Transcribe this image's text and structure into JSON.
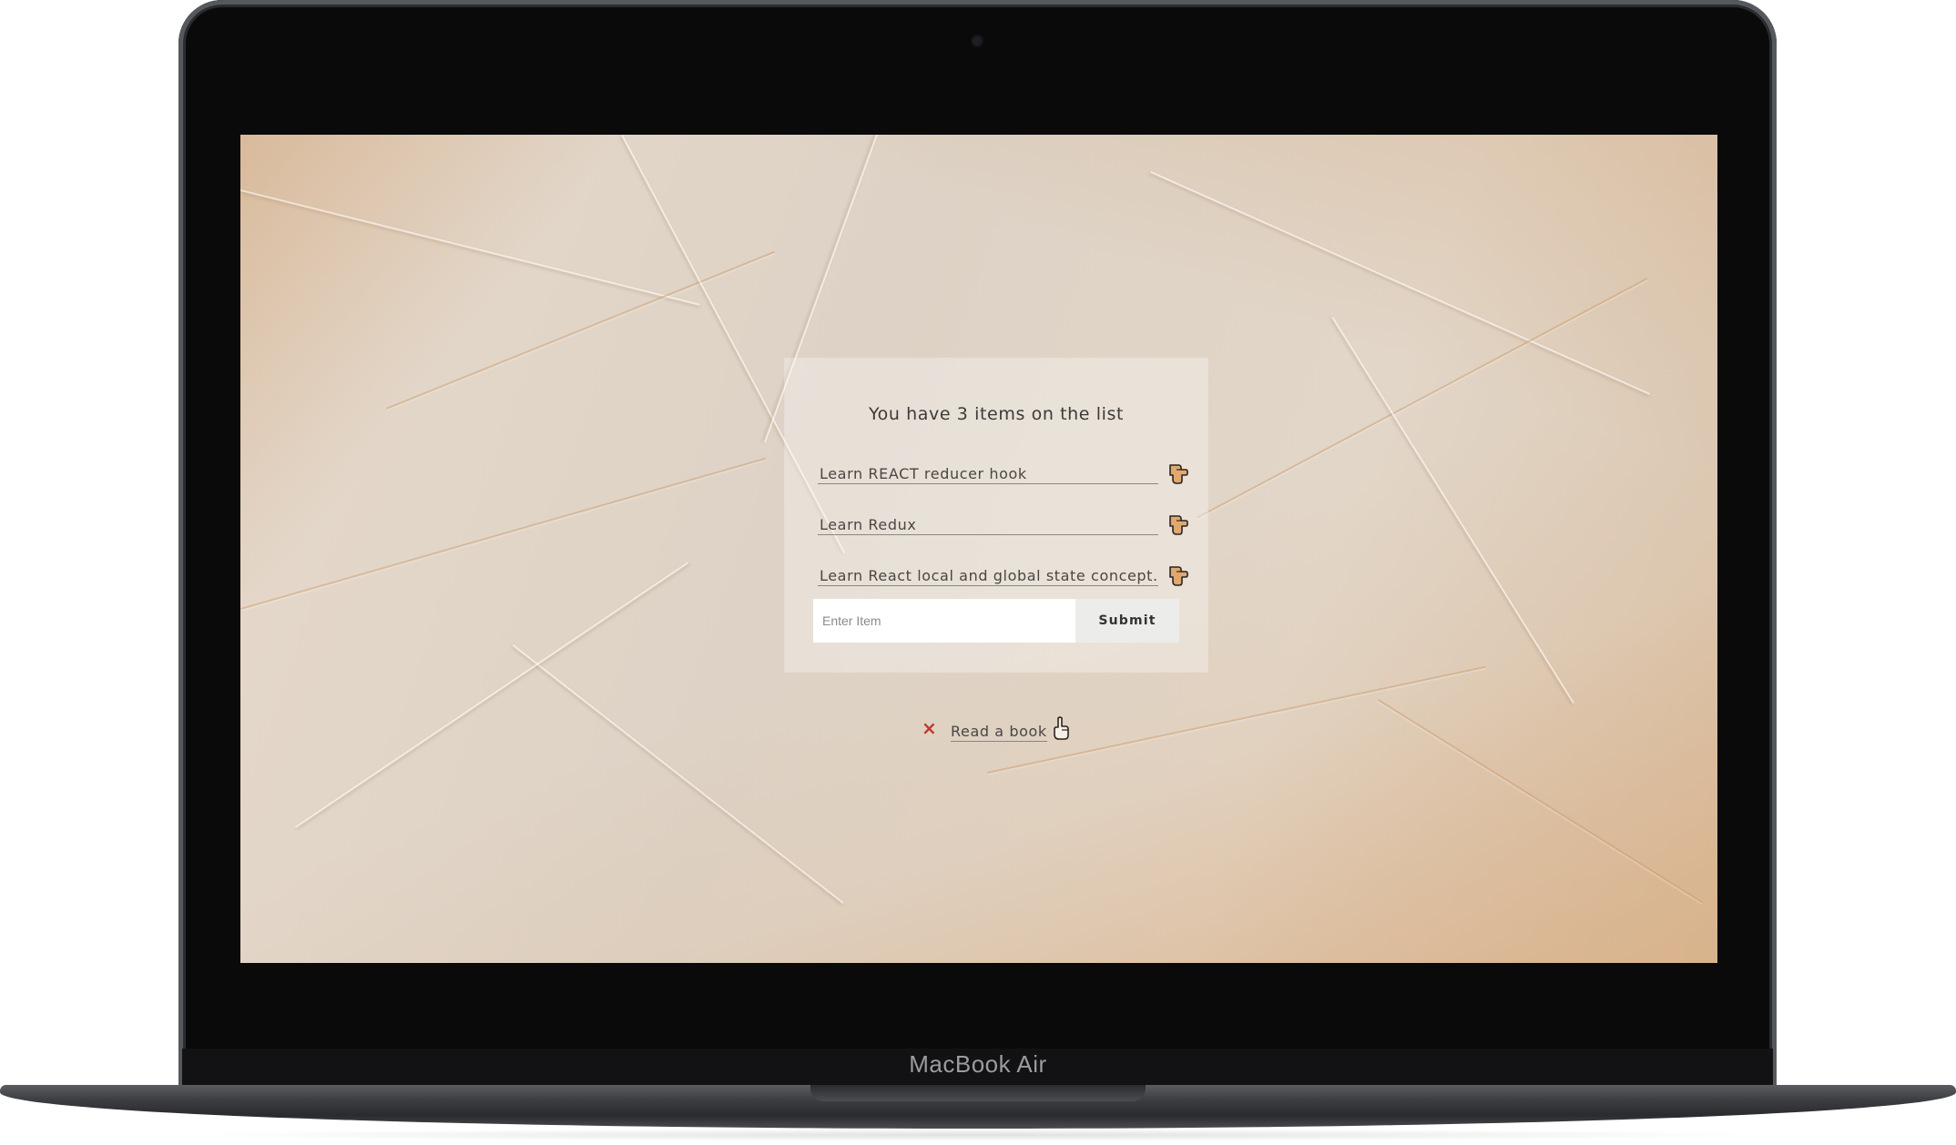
{
  "device": {
    "brand_label": "MacBook Air"
  },
  "app": {
    "title": "You have 3 items on the list",
    "items": [
      {
        "label": "Learn REACT reducer hook",
        "icon": "pointing-hand-icon"
      },
      {
        "label": "Learn Redux",
        "icon": "pointing-hand-icon"
      },
      {
        "label": "Learn React local and global state concept.",
        "icon": "pointing-hand-icon"
      }
    ],
    "form": {
      "input_placeholder": "Enter Item",
      "input_value": "",
      "submit_label": "Submit"
    },
    "completed": [
      {
        "label": "Read a book",
        "delete_icon": "×",
        "undo_icon": "pointing-up-hand-icon"
      }
    ]
  },
  "colors": {
    "accent_delete": "#c0392b",
    "icon_hand": "#e0a86f"
  }
}
